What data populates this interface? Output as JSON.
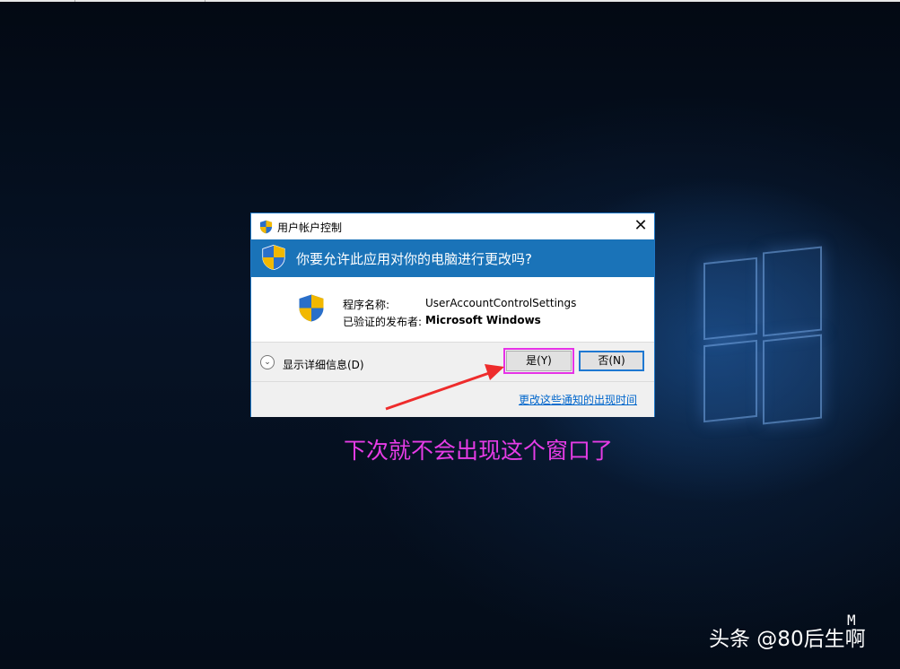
{
  "dialog": {
    "title": "用户帐户控制",
    "close_glyph": "✕",
    "question": "你要允许此应用对你的电脑进行更改吗?",
    "program_name_label": "程序名称:",
    "program_name_value": "UserAccountControlSettings",
    "publisher_label": "已验证的发布者:",
    "publisher_value": "Microsoft Windows",
    "show_details": "显示详细信息(D)",
    "expand_glyph": "⌄",
    "yes_button": "是(Y)",
    "no_button": "否(N)",
    "change_link": "更改这些通知的出现时间"
  },
  "annotation": {
    "text": "下次就不会出现这个窗口了",
    "color": "#e63ce6"
  },
  "watermark": {
    "text": "头条 @80后生啊",
    "overlay_letter": "M"
  },
  "icons": {
    "title": "uac-shield-icon",
    "header": "uac-shield-icon",
    "body": "uac-shield-icon"
  },
  "colors": {
    "header_bg": "#1a73b8",
    "dialog_border": "#1e78c8",
    "highlight": "#e632e6",
    "link": "#0066cc"
  }
}
